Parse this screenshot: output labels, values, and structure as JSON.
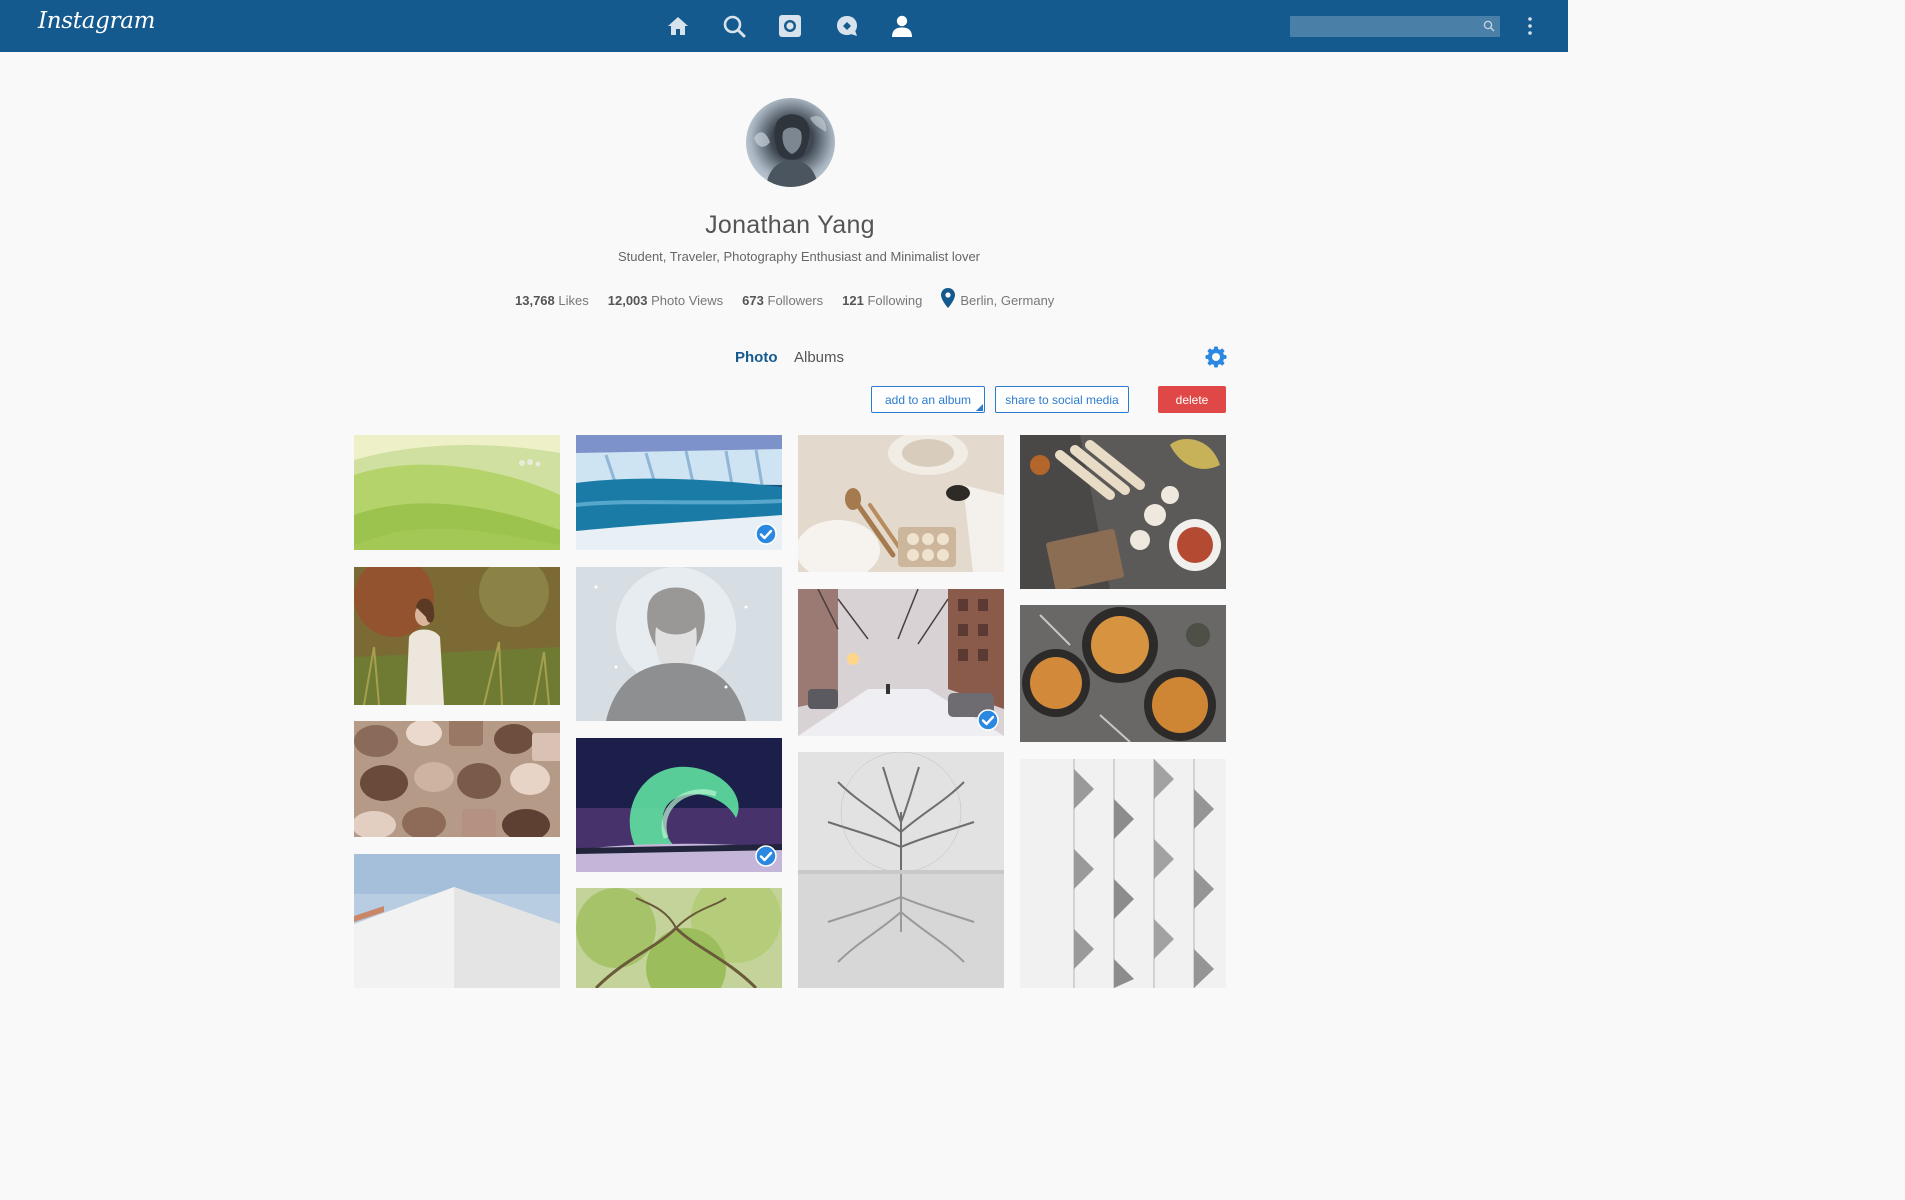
{
  "header": {
    "logo": "Instagram",
    "nav_icons": [
      "home-icon",
      "search-icon",
      "camera-icon",
      "chat-icon",
      "profile-icon"
    ],
    "search_placeholder": "",
    "brand_color": "#155a8e"
  },
  "profile": {
    "name": "Jonathan Yang",
    "bio": "Student, Traveler, Photography Enthusiast and Minimalist lover",
    "stats": [
      {
        "value": "13,768",
        "label": "Likes"
      },
      {
        "value": "12,003",
        "label": "Photo Views"
      },
      {
        "value": "673",
        "label": "Followers"
      },
      {
        "value": "121",
        "label": "Following"
      }
    ],
    "location": "Berlin, Germany"
  },
  "tabs": {
    "photo": "Photo",
    "albums": "Albums",
    "active": "Photo"
  },
  "actions": {
    "add_album": "add to an album",
    "share": "share to social media",
    "delete": "delete",
    "accent_color": "#2b7bd0",
    "delete_color": "#e04848"
  },
  "photos": [
    {
      "subject": "green rolling hills",
      "selected": false
    },
    {
      "subject": "frozen waterfall",
      "selected": true
    },
    {
      "subject": "baking flour and cookies",
      "selected": false
    },
    {
      "subject": "spring rolls and food platter",
      "selected": false
    },
    {
      "subject": "woman in meadow",
      "selected": true
    },
    {
      "subject": "bearded man in snow",
      "selected": false
    },
    {
      "subject": "snowy city street",
      "selected": true
    },
    {
      "subject": "pasta bowls",
      "selected": false
    },
    {
      "subject": "chocolate pralines",
      "selected": false
    },
    {
      "subject": "northern lights",
      "selected": true
    },
    {
      "subject": "tree reflection in fog",
      "selected": false
    },
    {
      "subject": "white building facade",
      "selected": false
    },
    {
      "subject": "white building against sky",
      "selected": false
    },
    {
      "subject": "green tree canopy",
      "selected": false
    }
  ]
}
